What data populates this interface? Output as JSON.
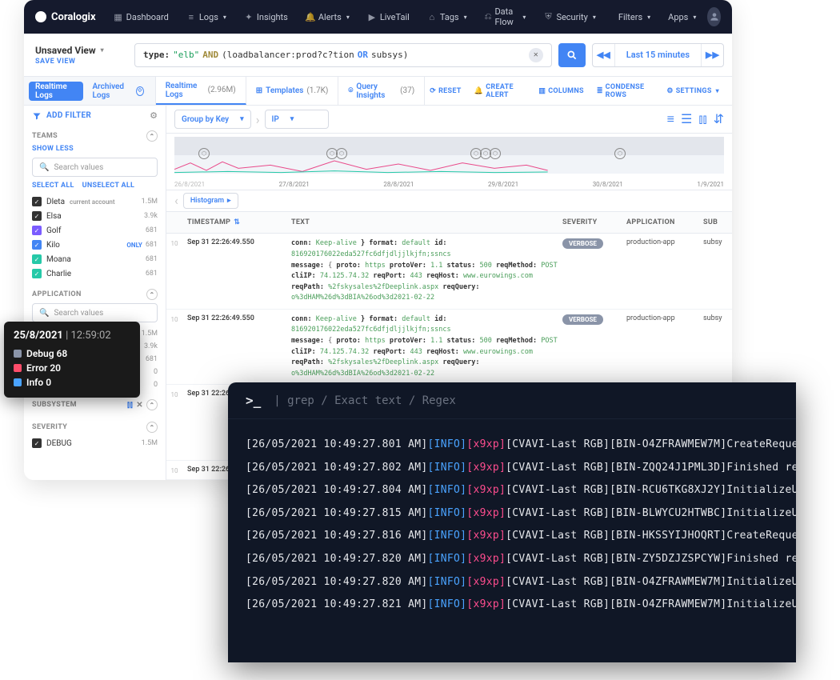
{
  "brand": "Coralogix",
  "nav": {
    "items": [
      {
        "label": "Dashboard"
      },
      {
        "label": "Logs",
        "caret": true
      },
      {
        "label": "Insights"
      },
      {
        "label": "Alerts",
        "caret": true
      },
      {
        "label": "LiveTail"
      },
      {
        "label": "Tags",
        "caret": true
      },
      {
        "label": "Data Flow",
        "caret": true
      },
      {
        "label": "Security",
        "caret": true
      }
    ],
    "right": {
      "filters": "Filters",
      "apps": "Apps"
    }
  },
  "view": {
    "title": "Unsaved View",
    "save": "SAVE VIEW"
  },
  "query": {
    "type_key": "type:",
    "type_val": "\"elb\"",
    "and": "AND",
    "expr1": "(loadbalancer:prod?c?tion",
    "or": "OR",
    "expr2": "subsys)"
  },
  "timerange": {
    "label": "Last 15 minutes"
  },
  "lefttabs": {
    "realtime": "Realtime Logs",
    "archived": "Archived Logs"
  },
  "midtabs": [
    {
      "label": "Realtime Logs",
      "count": "(2.96M)"
    },
    {
      "label": "Templates",
      "count": "(1.7K)"
    },
    {
      "label": "Query Insights",
      "count": "(37)"
    }
  ],
  "actions": {
    "reset": "RESET",
    "create_alert": "CREATE ALERT",
    "columns": "COLUMNS",
    "condense": "CONDENSE ROWS",
    "settings": "SETTINGS"
  },
  "sidebar": {
    "add_filter": "ADD FILTER",
    "teams_head": "TEAMS",
    "show_less": "SHOW LESS",
    "search_ph": "Search values",
    "select_all": "SELECT ALL",
    "unselect_all": "UNSELECT ALL",
    "teams": [
      {
        "name": "Dleta",
        "meta": "1.5M",
        "color": "#333",
        "current": true
      },
      {
        "name": "Elsa",
        "meta": "3.9k",
        "color": "#333"
      },
      {
        "name": "Golf",
        "meta": "681",
        "color": "#7b5cff"
      },
      {
        "name": "Kilo",
        "meta": "681",
        "color": "#4285f4",
        "only": true
      },
      {
        "name": "Moana",
        "meta": "681",
        "color": "#26c9a8"
      },
      {
        "name": "Charlie",
        "meta": "681",
        "color": "#26c9a8"
      }
    ],
    "app_head": "APPLICATION",
    "app_list": [
      {
        "meta": "1.5M"
      },
      {
        "meta": "3.9k"
      },
      {
        "meta": "681"
      },
      {
        "meta": "0"
      },
      {
        "meta": "0"
      }
    ],
    "subsystem_head": "SUBSYSTEM",
    "severity_head": "SEVERITY",
    "severity": {
      "label": "DEBUG",
      "meta": "1.5M"
    }
  },
  "controls": {
    "group": "Group by Key",
    "ip": "IP"
  },
  "chart": {
    "dates": [
      "26/8/2021",
      "27/8/2021",
      "28/8/2021",
      "29/8/2021",
      "30/8/2021",
      "1/9/2021"
    ],
    "histogram": "Histogram"
  },
  "table": {
    "idx": "10",
    "headers": {
      "ts": "TIMESTAMP",
      "text": "TEXT",
      "sev": "SEVERITY",
      "app": "APPLICATION",
      "sub": "SUB"
    },
    "ts": "Sep 31 22:26:49.550",
    "ts_short": "Sep 31 22:26:",
    "lines": {
      "l1_pre": "conn: ",
      "l1_v1": "Keep-alive",
      "l1_mid": " }  format: ",
      "l1_v2": "default",
      "l1_id": "  id: ",
      "l1_idv": "816920176022eda527fc6dfjdljjlkjfn;ssncs",
      "l2": "message: { proto: https  protoVer: 1.1  status: 500  reqMethod: POST",
      "l3": "cliIP: 74.125.74.32   reqPort: 443  reqHost: www.eurowings.com",
      "l4": "reqPath: %2fskysales%2fDeeplink.aspx   reqQuery: o%3dHAM%26d%3dBIA%26od%3d2021-02-22"
    },
    "sev": "VERBOSE",
    "app": "production-app",
    "sub": "subsy"
  },
  "tooltip": {
    "date": "25/8/2021",
    "time": "12:59:02",
    "rows": [
      {
        "label": "Debug 68",
        "color": "#8a94a8"
      },
      {
        "label": "Error 20",
        "color": "#ff4d6a"
      },
      {
        "label": "Info 0",
        "color": "#4aa3ff"
      }
    ]
  },
  "terminal": {
    "hint": "| grep / Exact text / Regex",
    "lines": [
      {
        "ts": "[26/05/2021 10:49:27.801 AM]",
        "bin": "[BIN-O4ZFRAWMEW7M]",
        "msg": "CreateReques"
      },
      {
        "ts": "[26/05/2021 10:49:27.802 AM]",
        "bin": "[BIN-ZQQ24J1PML3D]",
        "msg": "Finished rep"
      },
      {
        "ts": "[26/05/2021 10:49:27.804 AM]",
        "bin": "[BIN-RCU6TKG8XJ2Y]",
        "msg": "InitializeUs"
      },
      {
        "ts": "[26/05/2021 10:49:27.815 AM]",
        "bin": "[BIN-BLWYCU2HTWBC]",
        "msg": "InitializeUs"
      },
      {
        "ts": "[26/05/2021 10:49:27.816 AM]",
        "bin": "[BIN-HKSSYIJHOQRT]",
        "msg": "CreateReques"
      },
      {
        "ts": "[26/05/2021 10:49:27.820 AM]",
        "bin": "[BIN-ZY5DZJZSPCYW]",
        "msg": "Finished rep"
      },
      {
        "ts": "[26/05/2021 10:49:27.820 AM]",
        "bin": "[BIN-O4ZFRAWMEW7M]",
        "msg": "InitializeUs"
      },
      {
        "ts": "[26/05/2021 10:49:27.821 AM]",
        "bin": "[BIN-O4ZFRAWMEW7M]",
        "msg": "InitializeUs"
      }
    ],
    "info": "[INFO]",
    "x9": "[x9xp]",
    "cav": "[CVAVI-Last RGB]"
  }
}
